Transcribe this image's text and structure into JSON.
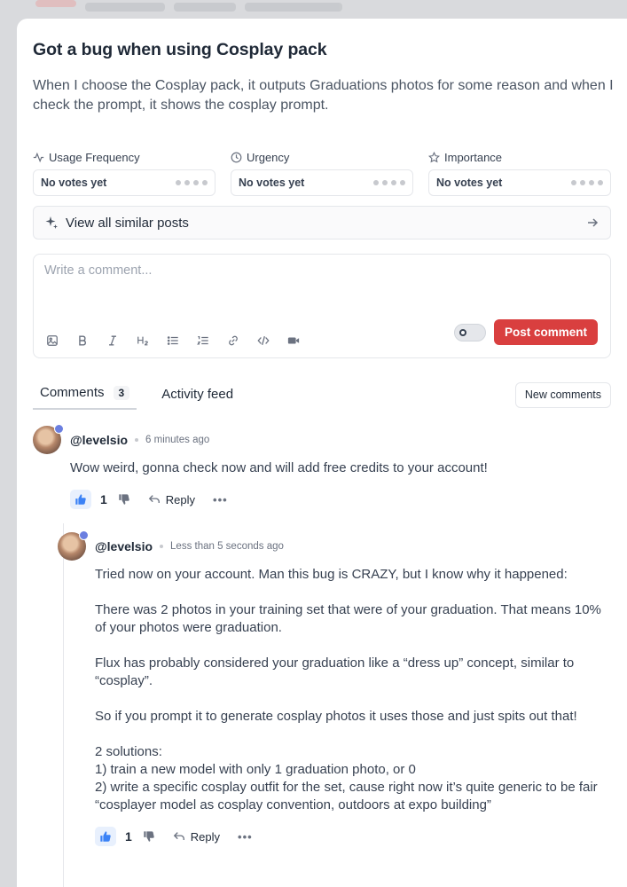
{
  "post": {
    "title": "Got a bug when using Cosplay pack",
    "description": "When I choose the Cosplay pack, it outputs Graduations photos for some reason and when I check the prompt, it shows the cosplay prompt."
  },
  "votes": [
    {
      "label": "Usage Frequency",
      "value": "No votes yet",
      "icon": "activity-icon"
    },
    {
      "label": "Urgency",
      "value": "No votes yet",
      "icon": "clock-icon"
    },
    {
      "label": "Importance",
      "value": "No votes yet",
      "icon": "star-icon"
    }
  ],
  "similar": {
    "label": "View all similar posts"
  },
  "composer": {
    "placeholder": "Write a comment...",
    "post_label": "Post comment"
  },
  "tabs": {
    "comments_label": "Comments",
    "comments_count": "3",
    "activity_label": "Activity feed",
    "new_comments_label": "New comments"
  },
  "comments": [
    {
      "user": "@levelsio",
      "time": "6 minutes ago",
      "text": "Wow weird, gonna check now and will add free credits to your account!",
      "likes": "1",
      "reply_label": "Reply",
      "more": "•••"
    },
    {
      "user": "@levelsio",
      "time": "Less than 5 seconds ago",
      "text": "Tried now on your account. Man this bug is CRAZY, but I know why it happened:\n\nThere was 2 photos in your training set that were of your graduation. That means 10% of your photos were graduation.\n\nFlux has probably considered your graduation like a “dress up” concept, similar to “cosplay”.\n\nSo if you prompt it to generate cosplay photos it uses those and just spits out that!\n\n2 solutions:\n1) train a new model with only 1 graduation photo, or 0\n2) write a specific cosplay outfit for the set, cause right now it’s quite generic to be fair “cosplayer model as cosplay convention, outdoors at expo building”",
      "likes": "1",
      "reply_label": "Reply",
      "more": "•••"
    }
  ],
  "colors": {
    "accent": "#d93f3f",
    "like_bg": "#e8f0fd",
    "verified": "#6b7fe0"
  }
}
